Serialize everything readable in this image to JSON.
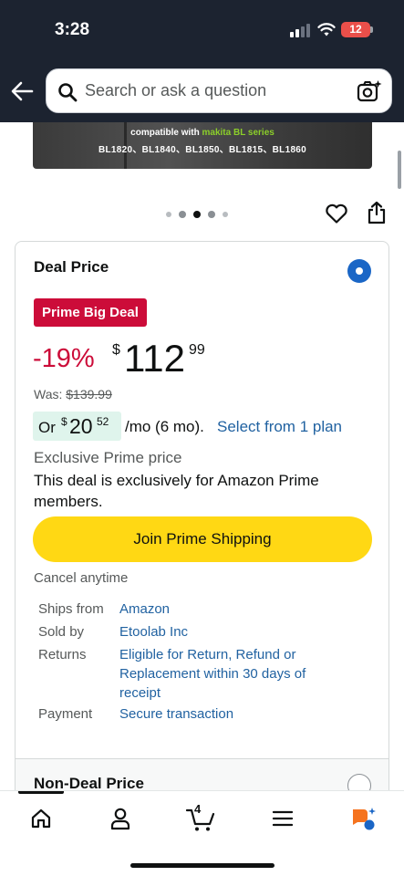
{
  "status_bar": {
    "time": "3:28",
    "battery": "12"
  },
  "search": {
    "placeholder": "Search or ask a question"
  },
  "product_image": {
    "line1_prefix": "compatible with ",
    "line1_brand": "makita BL series",
    "line2": "BL1820、BL1840、BL1850、BL1815、BL1860"
  },
  "deal": {
    "title": "Deal Price",
    "badge": "Prime Big Deal",
    "discount": "-19%",
    "currency": "$",
    "price_whole": "112",
    "price_fraction": "99",
    "was_label": "Was: ",
    "was_price": "$139.99",
    "monthly_prefix": "Or",
    "monthly_currency": "$",
    "monthly_whole": "20",
    "monthly_fraction": "52",
    "monthly_suffix": "/mo (6 mo).",
    "plan_link": "Select from 1 plan",
    "exclusive_label": "Exclusive Prime price",
    "exclusive_text": "This deal is exclusively for Amazon Prime members.",
    "join_button": "Join Prime Shipping",
    "cancel_text": "Cancel anytime",
    "info": [
      {
        "label": "Ships from",
        "value": "Amazon"
      },
      {
        "label": "Sold by",
        "value": "Etoolab Inc"
      },
      {
        "label": "Returns",
        "value": "Eligible for Return, Refund or Replacement within 30 days of receipt"
      },
      {
        "label": "Payment",
        "value": "Secure transaction"
      }
    ]
  },
  "non_deal": {
    "title": "Non-Deal Price"
  },
  "bottom_nav": {
    "items": [
      "home-icon",
      "account-icon",
      "cart-icon",
      "menu-icon",
      "rufus-icon"
    ],
    "cart_count": "4"
  },
  "colors": {
    "header_bg": "#1c2330",
    "deal_red": "#cc0c39",
    "link_blue": "#2162a1",
    "button_yellow": "#ffd814",
    "monthly_bg": "#dff4ec",
    "radio_blue": "#1a66c6"
  }
}
